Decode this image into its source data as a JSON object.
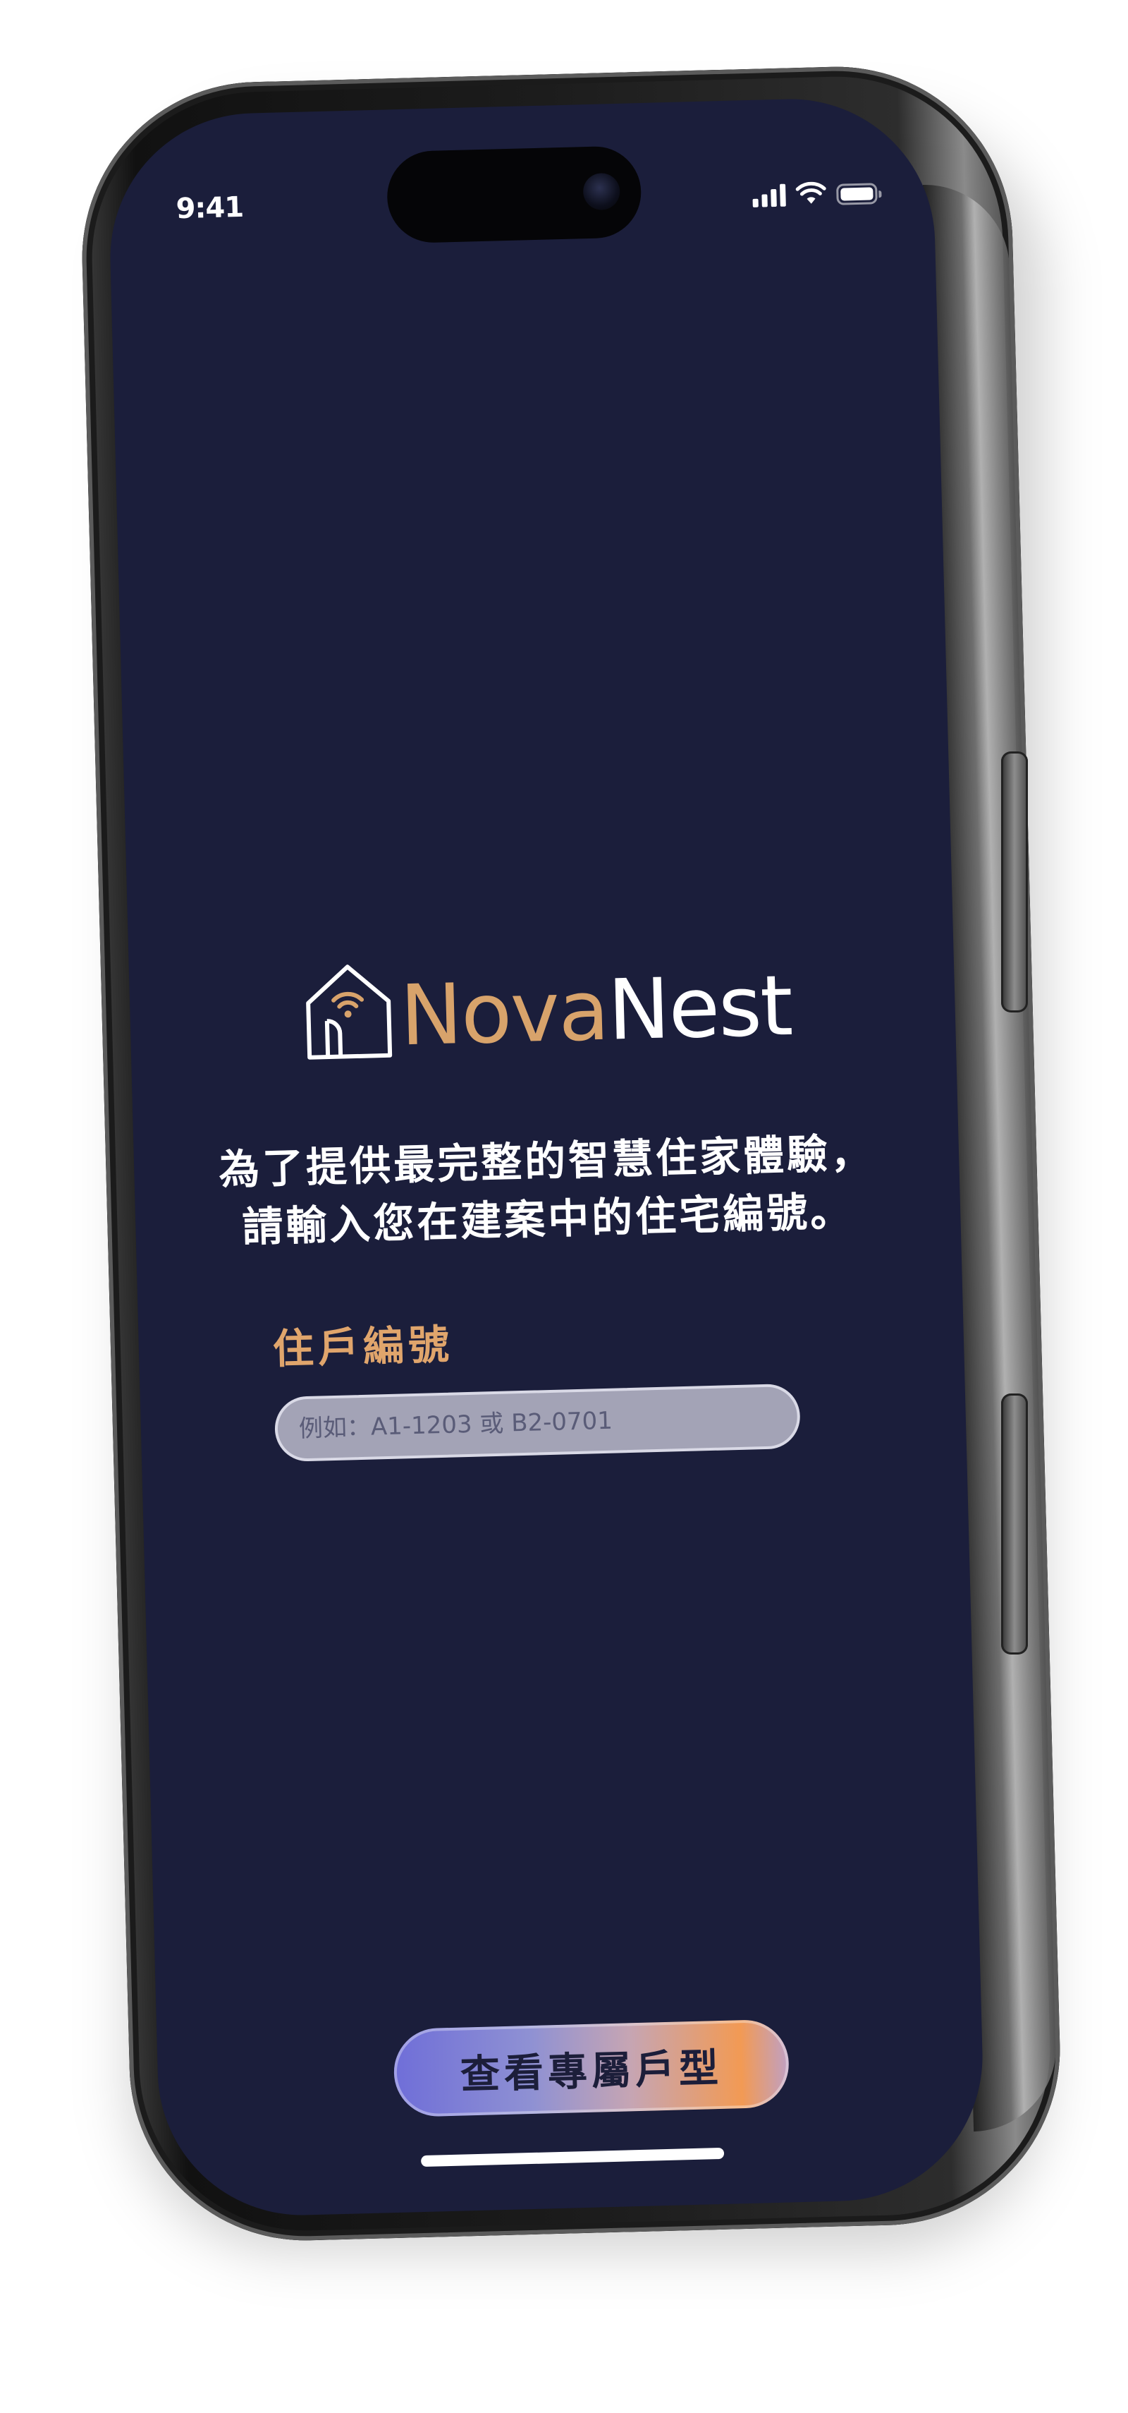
{
  "status_bar": {
    "time": "9:41"
  },
  "brand": {
    "name_part1": "Nova",
    "name_part2": "Nest",
    "accent_color": "#d8a36b"
  },
  "intro": {
    "line1": "為了提供最完整的智慧住家體驗，",
    "line2": "請輸入您在建案中的住宅編號。"
  },
  "unit_field": {
    "label": "住戶編號",
    "value": "",
    "placeholder": "例如：A1-1203 或 B2-0701"
  },
  "cta": {
    "label": "查看專屬戶型"
  },
  "colors": {
    "screen_background": "#1b1e3b",
    "label_color": "#e0a56c"
  }
}
